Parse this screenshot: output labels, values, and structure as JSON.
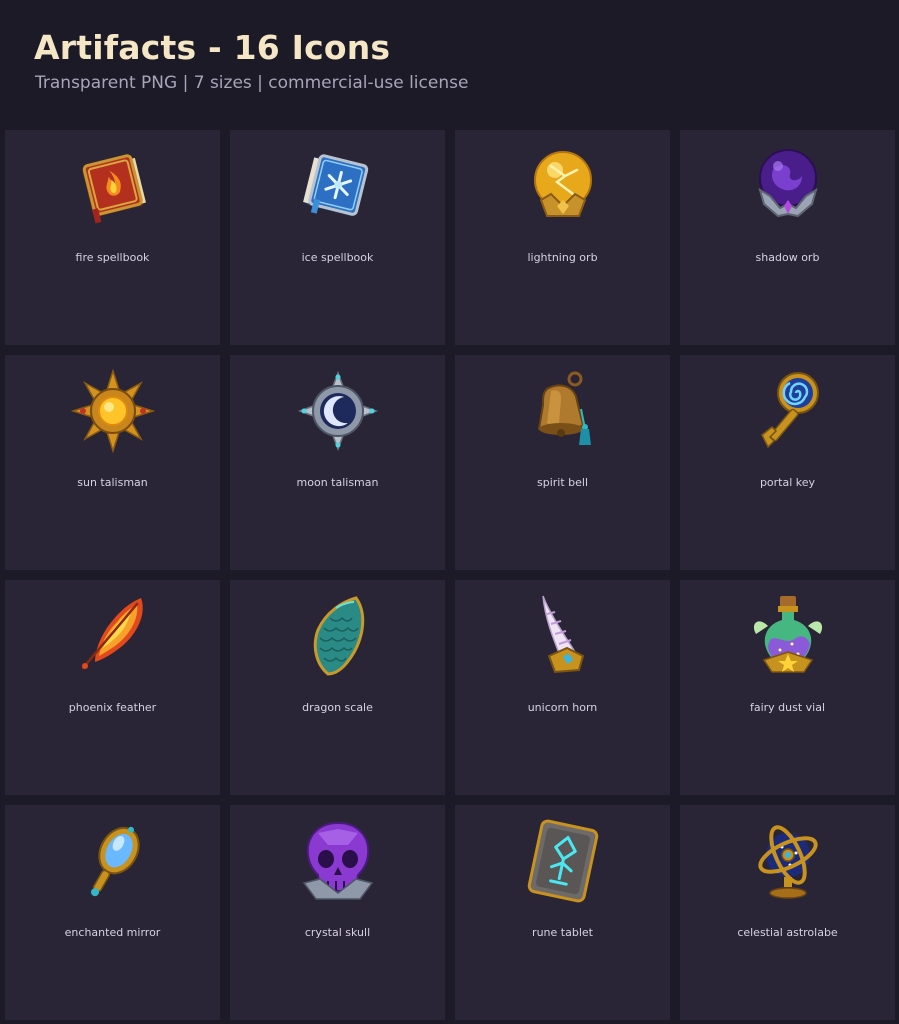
{
  "header": {
    "title": "Artifacts - 16 Icons",
    "subtitle": "Transparent PNG | 7 sizes | commercial-use license"
  },
  "colors": {
    "background": "#1c1a26",
    "card": "#2a2536",
    "title": "#f5e7c6",
    "subtitle": "#a9a4b8",
    "label": "#d6d2e0"
  },
  "items": [
    {
      "label": "fire spellbook",
      "icon": "fire-spellbook-icon"
    },
    {
      "label": "ice spellbook",
      "icon": "ice-spellbook-icon"
    },
    {
      "label": "lightning orb",
      "icon": "lightning-orb-icon"
    },
    {
      "label": "shadow orb",
      "icon": "shadow-orb-icon"
    },
    {
      "label": "sun talisman",
      "icon": "sun-talisman-icon"
    },
    {
      "label": "moon talisman",
      "icon": "moon-talisman-icon"
    },
    {
      "label": "spirit bell",
      "icon": "spirit-bell-icon"
    },
    {
      "label": "portal key",
      "icon": "portal-key-icon"
    },
    {
      "label": "phoenix feather",
      "icon": "phoenix-feather-icon"
    },
    {
      "label": "dragon scale",
      "icon": "dragon-scale-icon"
    },
    {
      "label": "unicorn horn",
      "icon": "unicorn-horn-icon"
    },
    {
      "label": "fairy dust vial",
      "icon": "fairy-dust-vial-icon"
    },
    {
      "label": "enchanted mirror",
      "icon": "enchanted-mirror-icon"
    },
    {
      "label": "crystal skull",
      "icon": "crystal-skull-icon"
    },
    {
      "label": "rune tablet",
      "icon": "rune-tablet-icon"
    },
    {
      "label": "celestial astrolabe",
      "icon": "celestial-astrolabe-icon"
    }
  ]
}
